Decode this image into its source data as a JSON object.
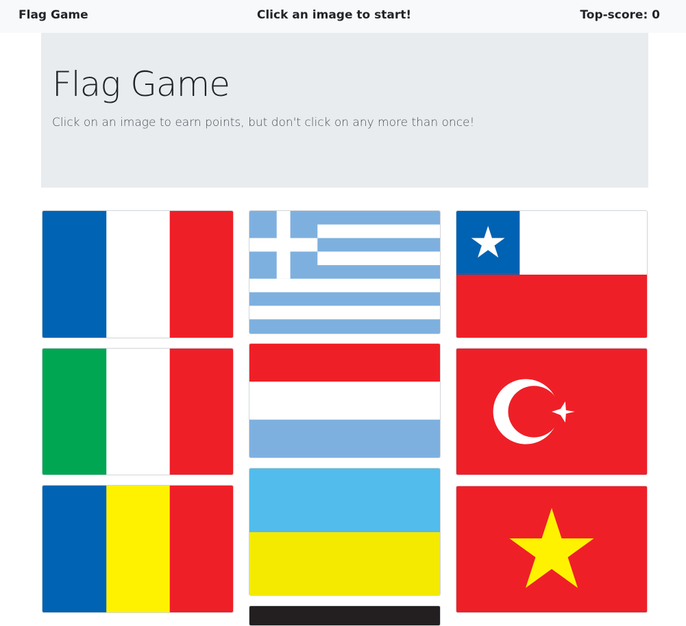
{
  "navbar": {
    "brand": "Flag Game",
    "status": "Click an image to start!",
    "top_score": "Top-score: 0"
  },
  "header": {
    "title": "Flag Game",
    "subtitle": "Click on an image to earn points, but don't click on any more than once!"
  },
  "flags": [
    {
      "icon": "france-flag-icon",
      "colors": [
        "#0063b3",
        "#ffffff",
        "#ef1f27"
      ]
    },
    {
      "icon": "greece-flag-icon",
      "colors": [
        "#7eb0df",
        "#ffffff"
      ]
    },
    {
      "icon": "chile-flag-icon",
      "colors": [
        "#0062b2",
        "#ffffff",
        "#ef1f27"
      ]
    },
    {
      "icon": "italy-flag-icon",
      "colors": [
        "#00a651",
        "#ffffff",
        "#ef1f27"
      ]
    },
    {
      "icon": "paraguay-flag-icon",
      "colors": [
        "#ef1f27",
        "#ffffff",
        "#7eb0df"
      ]
    },
    {
      "icon": "turkey-flag-icon",
      "colors": [
        "#ef1f27",
        "#ffffff"
      ]
    },
    {
      "icon": "romania-flag-icon",
      "colors": [
        "#0063b3",
        "#fff200",
        "#ef1f27"
      ]
    },
    {
      "icon": "ukraine-flag-icon",
      "colors": [
        "#52bcec",
        "#f3ea00"
      ]
    },
    {
      "icon": "vietnam-flag-icon",
      "colors": [
        "#ef1f27",
        "#fff200"
      ]
    },
    {
      "icon": "dark-flag-icon",
      "colors": [
        "#231f20"
      ]
    }
  ]
}
